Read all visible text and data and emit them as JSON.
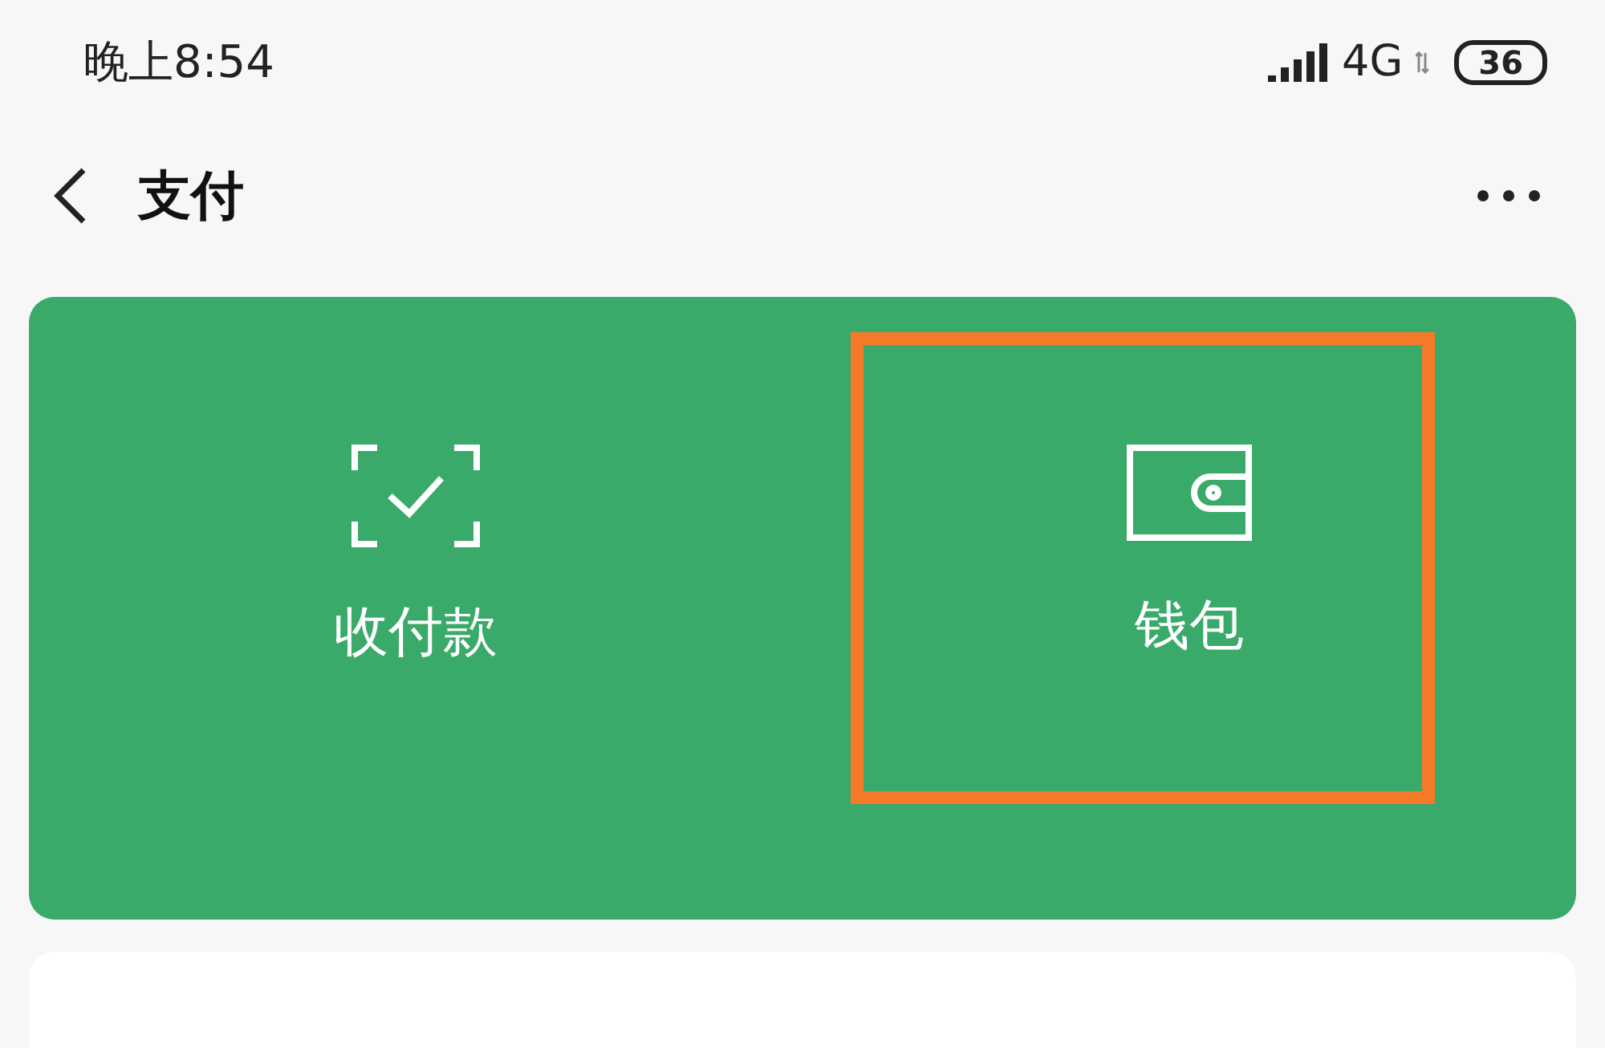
{
  "status_bar": {
    "time": "晚上8:54",
    "network": "4G",
    "battery": "36"
  },
  "header": {
    "title": "支付"
  },
  "pay_card": {
    "items": [
      {
        "label": "收付款",
        "kind": "scan"
      },
      {
        "label": "钱包",
        "kind": "wallet",
        "highlighted": true
      }
    ]
  }
}
